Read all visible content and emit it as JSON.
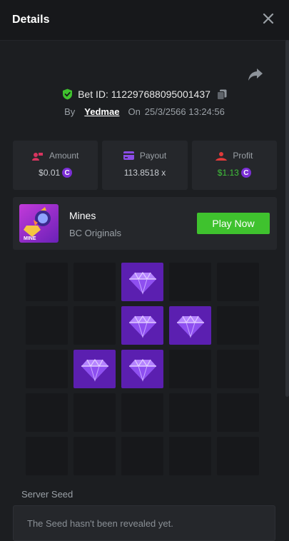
{
  "header": {
    "title": "Details"
  },
  "bet": {
    "id_text": "Bet ID: 112297688095001437",
    "by_label": "By",
    "username": "Yedmae",
    "on_label": "On",
    "date": "25/3/2566 13:24:56"
  },
  "stats": [
    {
      "label": "Amount",
      "value": "$0.01",
      "coin": true,
      "icon": "amount-icon",
      "color": "#d8345f"
    },
    {
      "label": "Payout",
      "value": "113.8518 x",
      "coin": false,
      "icon": "card-icon",
      "color": "#8a4ce6"
    },
    {
      "label": "Profit",
      "value": "$1.13",
      "coin": true,
      "icon": "profit-icon",
      "color": "#e03a3a"
    }
  ],
  "coin_symbol": "C",
  "game": {
    "name": "Mines",
    "provider": "BC Originals",
    "play_label": "Play Now",
    "thumb_text": "MINE"
  },
  "board": {
    "rows": 5,
    "cols": 5,
    "gems": [
      [
        0,
        2
      ],
      [
        1,
        2
      ],
      [
        1,
        3
      ],
      [
        2,
        1
      ],
      [
        2,
        2
      ]
    ]
  },
  "seed": {
    "label": "Server Seed",
    "text": "The Seed hasn't been revealed yet."
  },
  "colors": {
    "accent_green": "#3fc22e",
    "gem_tile": "#5b1fb0",
    "shield": "#3fc22e"
  }
}
